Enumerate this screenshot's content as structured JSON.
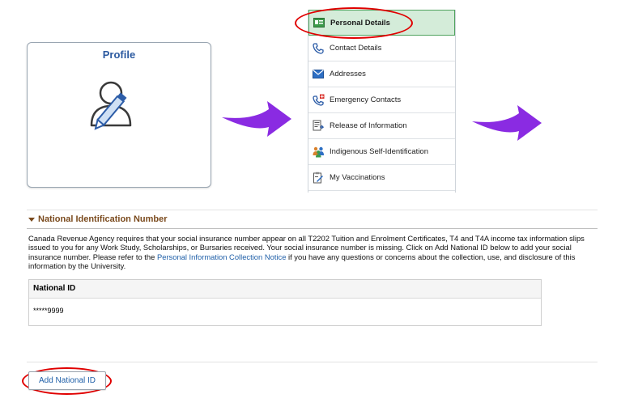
{
  "profile_tile": {
    "title": "Profile"
  },
  "side_menu": {
    "items": [
      {
        "label": "Personal Details",
        "icon": "id-card-icon",
        "active": true
      },
      {
        "label": "Contact Details",
        "icon": "phone-icon",
        "active": false
      },
      {
        "label": "Addresses",
        "icon": "envelope-icon",
        "active": false
      },
      {
        "label": "Emergency Contacts",
        "icon": "emergency-phone-icon",
        "active": false
      },
      {
        "label": "Release of Information",
        "icon": "document-release-icon",
        "active": false
      },
      {
        "label": "Indigenous Self-Identification",
        "icon": "people-icon",
        "active": false
      },
      {
        "label": "My Vaccinations",
        "icon": "clipboard-icon",
        "active": false
      }
    ]
  },
  "section": {
    "title": "National Identification Number",
    "text_part1": "Canada Revenue Agency requires that your social insurance number appear on all T2202 Tuition and Enrolment Certificates, T4 and T4A income tax information slips issued to you for any Work Study, Scholarships, or Bursaries received. Your social insurance number is missing. Click on Add National ID below to add your social insurance number. Please refer to the ",
    "link_text": "Personal Information Collection Notice",
    "text_part2": " if you have any questions or concerns about the collection, use, and disclosure of this information by the University."
  },
  "table": {
    "header": "National ID",
    "rows": [
      "*****9999"
    ]
  },
  "add_button": {
    "label": "Add National ID"
  },
  "colors": {
    "accent": "#8a2be2",
    "highlight_oval": "#e00000",
    "link": "#1f5fa8",
    "active_menu_bg": "#d4ecd9",
    "section_title": "#7a4a1d"
  }
}
